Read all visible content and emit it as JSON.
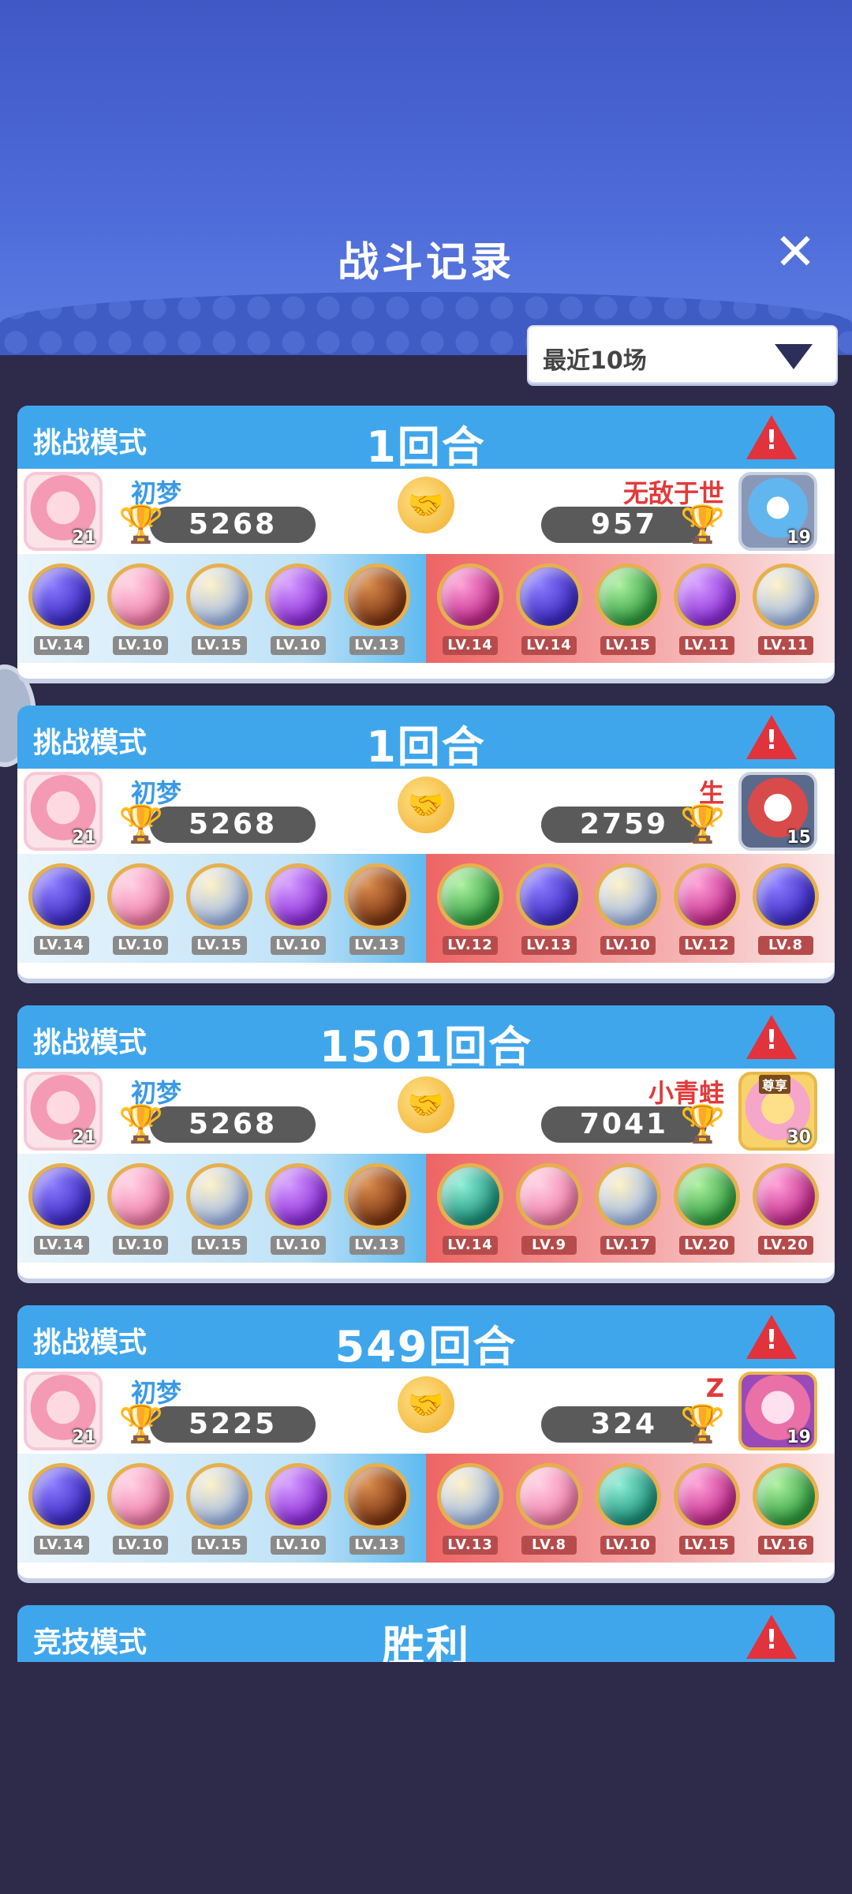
{
  "header": {
    "title": "战斗记录",
    "close_icon": "close-icon"
  },
  "filter": {
    "label": "最近10场",
    "icon": "chevron-down-icon"
  },
  "records": [
    {
      "mode": "挑战模式",
      "rounds": "1回合",
      "me": {
        "name": "初梦",
        "score": "5268",
        "level": "21"
      },
      "opponent": {
        "name": "无敌于世",
        "score": "957",
        "level": "19"
      },
      "my_team": [
        "LV.14",
        "LV.10",
        "LV.15",
        "LV.10",
        "LV.13"
      ],
      "op_team": [
        "LV.14",
        "LV.14",
        "LV.15",
        "LV.11",
        "LV.11"
      ]
    },
    {
      "mode": "挑战模式",
      "rounds": "1回合",
      "me": {
        "name": "初梦",
        "score": "5268",
        "level": "21"
      },
      "opponent": {
        "name": "生",
        "score": "2759",
        "level": "15"
      },
      "my_team": [
        "LV.14",
        "LV.10",
        "LV.15",
        "LV.10",
        "LV.13"
      ],
      "op_team": [
        "LV.12",
        "LV.13",
        "LV.10",
        "LV.12",
        "LV.8"
      ]
    },
    {
      "mode": "挑战模式",
      "rounds": "1501回合",
      "me": {
        "name": "初梦",
        "score": "5268",
        "level": "21"
      },
      "opponent": {
        "name": "小青蛙",
        "score": "7041",
        "level": "30",
        "badge": "尊享"
      },
      "my_team": [
        "LV.14",
        "LV.10",
        "LV.15",
        "LV.10",
        "LV.13"
      ],
      "op_team": [
        "LV.14",
        "LV.9",
        "LV.17",
        "LV.20",
        "LV.20"
      ]
    },
    {
      "mode": "挑战模式",
      "rounds": "549回合",
      "me": {
        "name": "初梦",
        "score": "5225",
        "level": "21"
      },
      "opponent": {
        "name": "Z",
        "score": "324",
        "level": "19"
      },
      "my_team": [
        "LV.14",
        "LV.10",
        "LV.15",
        "LV.10",
        "LV.13"
      ],
      "op_team": [
        "LV.13",
        "LV.8",
        "LV.10",
        "LV.15",
        "LV.16"
      ]
    }
  ],
  "partial_record": {
    "mode": "竞技模式",
    "result": "胜利"
  },
  "colors": {
    "header_blue": "#4d6ad8",
    "card_header": "#3fa6ec",
    "warn_red": "#e2323c",
    "my_name": "#3b9ae6",
    "op_name": "#e23a3a"
  }
}
